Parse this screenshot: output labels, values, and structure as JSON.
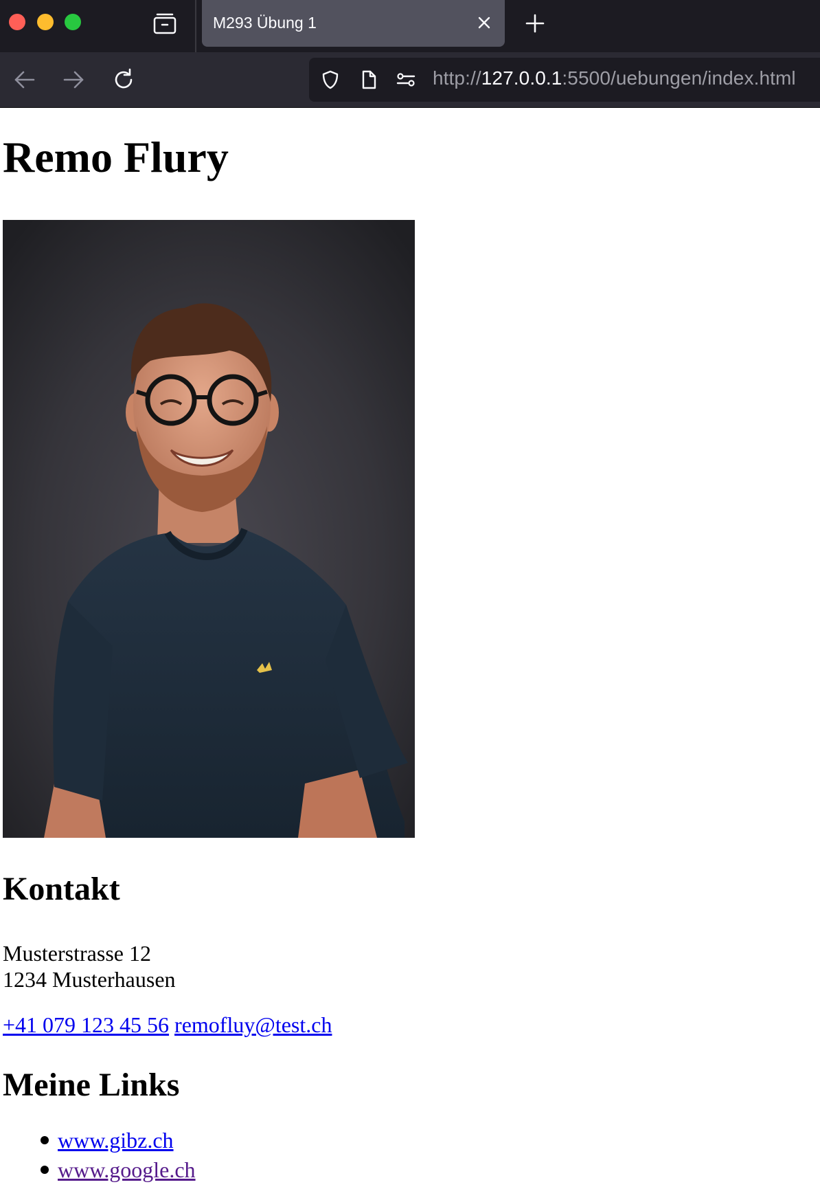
{
  "browser": {
    "tab_title": "M293 Übung 1",
    "url_prefix": "http://",
    "url_host": "127.0.0.1",
    "url_rest": ":5500/uebungen/index.html"
  },
  "page": {
    "name": "Remo Flury",
    "photo_alt": "Portrait photo",
    "contact_heading": "Kontakt",
    "address_line1": "Musterstrasse 12",
    "address_line2": "1234 Musterhausen",
    "phone": "+41 079 123 45 56",
    "email": "remofluy@test.ch",
    "links_heading": "Meine Links",
    "links": [
      {
        "label": "www.gibz.ch"
      },
      {
        "label": "www.google.ch"
      }
    ]
  }
}
